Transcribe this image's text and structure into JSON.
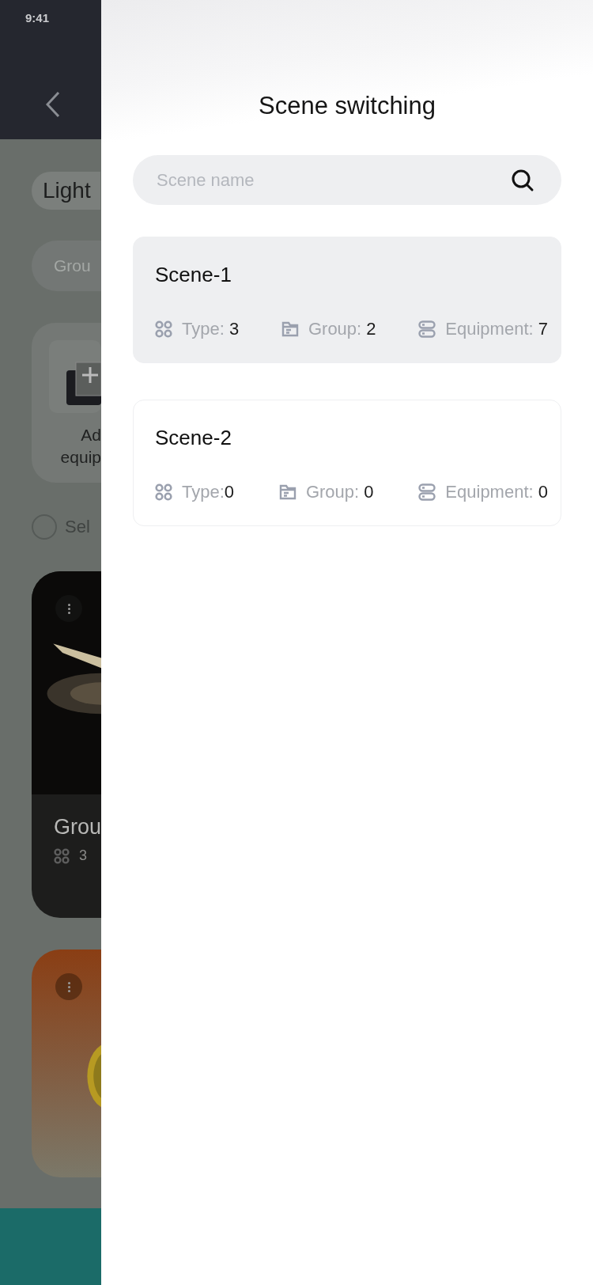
{
  "status_bar": {
    "time": "9:41"
  },
  "background": {
    "tab": "Light",
    "group_field": {
      "placeholder": "Grou"
    },
    "add_tile": {
      "lines": [
        "Ad",
        "equip"
      ]
    },
    "select_all": {
      "label": "Sel",
      "checked": false
    },
    "group_cards": [
      {
        "kind": "lamp",
        "title": "Grou",
        "count": "3"
      },
      {
        "kind": "coin"
      }
    ]
  },
  "drawer": {
    "title": "Scene switching",
    "search": {
      "placeholder": "Scene name"
    },
    "scenes": [
      {
        "name": "Scene-1",
        "selected": true,
        "stats": [
          {
            "kind": "type",
            "label": "Type: ",
            "value": "3"
          },
          {
            "kind": "group",
            "label": "Group: ",
            "value": "2"
          },
          {
            "kind": "equipment",
            "label": "Equipment: ",
            "value": "7"
          }
        ]
      },
      {
        "name": "Scene-2",
        "selected": false,
        "stats": [
          {
            "kind": "type",
            "label": "Type:",
            "value": "0"
          },
          {
            "kind": "group",
            "label": "Group: ",
            "value": "0"
          },
          {
            "kind": "equipment",
            "label": "Equipment: ",
            "value": "0"
          }
        ]
      }
    ]
  }
}
